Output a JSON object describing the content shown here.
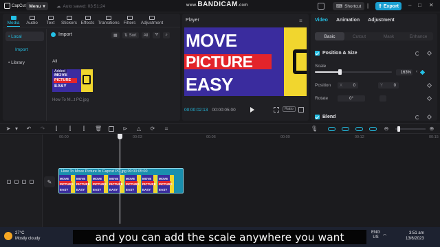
{
  "titlebar": {
    "app_name": "CapCut",
    "menu_label": "Menu",
    "autosave": "Auto saved: 03:51:24",
    "watermark_url": "www.",
    "watermark": "BANDICAM",
    "watermark_suffix": ".com",
    "shortcut_label": "Shortcut",
    "export_label": "Export"
  },
  "media_tabs": [
    {
      "label": "Media",
      "active": true
    },
    {
      "label": "Audio"
    },
    {
      "label": "Text"
    },
    {
      "label": "Stickers"
    },
    {
      "label": "Effects"
    },
    {
      "label": "Transitions"
    },
    {
      "label": "Filters"
    },
    {
      "label": "Adjustment"
    }
  ],
  "media_side": {
    "local": "• Local",
    "import": "Import",
    "library": "• Library"
  },
  "media_main": {
    "import_label": "Import",
    "sort_label": "Sort",
    "filter_label": "All",
    "all_label": "All",
    "thumb_badge": "Added",
    "thumb_lines": [
      "MOVE",
      "PICTURE",
      "EASY"
    ],
    "thumb_name": "How To M...t PC.jpg"
  },
  "player": {
    "title": "Player",
    "video_lines": [
      "MOVE",
      "PICTURE",
      "EASY"
    ],
    "time_current": "00:00:02:13",
    "time_total": "00:00:05:00",
    "ratio_label": "Ratio"
  },
  "props": {
    "tabs": [
      {
        "label": "Video",
        "active": true
      },
      {
        "label": "Animation"
      },
      {
        "label": "Adjustment"
      }
    ],
    "subtabs": [
      {
        "label": "Basic",
        "active": true
      },
      {
        "label": "Cutout"
      },
      {
        "label": "Mask"
      },
      {
        "label": "Enhance"
      }
    ],
    "section_position": "Position & Size",
    "scale_label": "Scale",
    "scale_value": "163%",
    "scale_fraction": 0.32,
    "position_label": "Position",
    "x_key": "X",
    "x_value": "0",
    "y_key": "Y",
    "y_value": "0",
    "rotate_label": "Rotate",
    "rotate_value": "0°",
    "section_blend": "Blend"
  },
  "timeline": {
    "ticks": [
      "00:00",
      "00:03",
      "00:06",
      "00:09",
      "00:12",
      "00:15"
    ],
    "clip_label": "How To Move Picture In Capcut PC.jpg  00:00:05:00",
    "frame_lines": [
      "MOVE",
      "PICTURE",
      "EASY"
    ]
  },
  "subtitle": "and you can add the scale anywhere you want",
  "taskbar": {
    "temp": "27°C",
    "weather": "Mostly cloudy",
    "lang_top": "ENG",
    "lang_bottom": "US",
    "time": "3:51 am",
    "date": "13/6/2023"
  }
}
